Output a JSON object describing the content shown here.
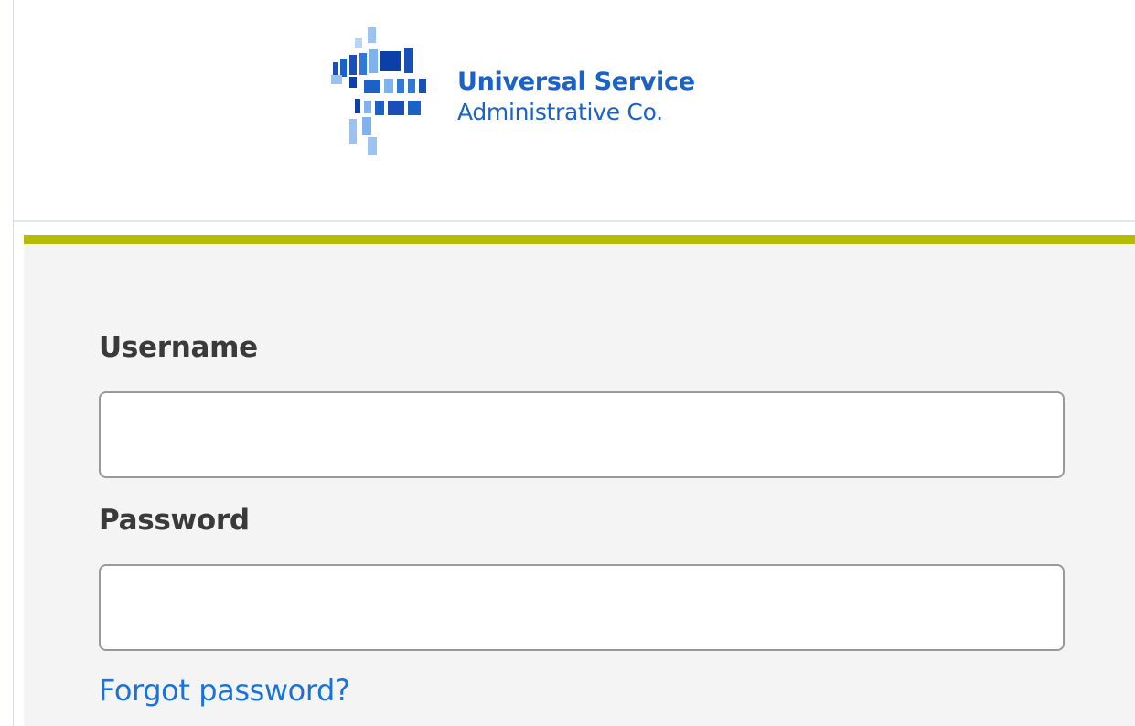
{
  "brand": {
    "name_line1": "Universal Service",
    "name_line2": "Administrative Co.",
    "primary_color": "#1a62c7",
    "light_color": "#7fb2ee",
    "accent_color": "#b5bd00",
    "icon": "usac-logo-mark"
  },
  "login_form": {
    "username": {
      "label": "Username",
      "value": "",
      "placeholder": ""
    },
    "password": {
      "label": "Password",
      "value": "",
      "placeholder": ""
    },
    "forgot_password_label": "Forgot password?",
    "link_color": "#1a73d9"
  }
}
